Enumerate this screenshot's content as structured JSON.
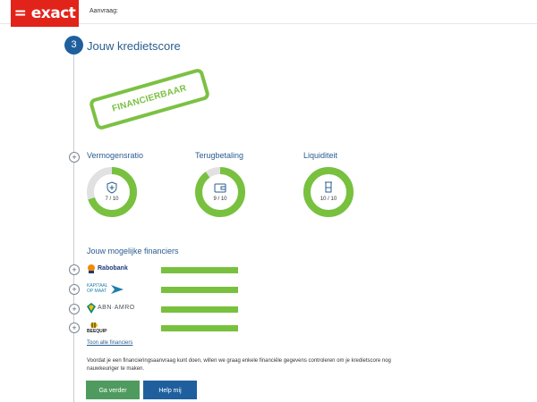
{
  "header": {
    "logo_text": "= exact",
    "aanvraag_label": "Aanvraag:"
  },
  "step": {
    "number": "3",
    "title": "Jouw kredietscore"
  },
  "stamp": {
    "text": "FINANCIERBAAR"
  },
  "metrics": [
    {
      "label": "Vermogensratio",
      "score": "7 / 10",
      "value": 7,
      "max": 10,
      "icon": "shield-plus-icon"
    },
    {
      "label": "Terugbetaling",
      "score": "9 / 10",
      "value": 9,
      "max": 10,
      "icon": "wallet-icon"
    },
    {
      "label": "Liquiditeit",
      "score": "10 / 10",
      "value": 10,
      "max": 10,
      "icon": "beaker-icon"
    }
  ],
  "financiers": {
    "title": "Jouw mogelijke financiers",
    "items": [
      {
        "name": "Rabobank"
      },
      {
        "name": "KAPITAAL OP MAAT"
      },
      {
        "name": "ABN·AMRO"
      },
      {
        "name": "BEEQUIP"
      }
    ],
    "show_all_link": "Toon alle financiers"
  },
  "info_text": "Voordat je een financieringsaanvraag kunt doen, willen we graag enkele financiële gegevens controleren om je kredietscore nog nauwkeuriger te maken.",
  "buttons": {
    "continue": "Ga verder",
    "help": "Help mij"
  },
  "colors": {
    "brand_red": "#e2231a",
    "score_green": "#78c13f",
    "track_gray": "#e1e1e1",
    "primary_blue": "#1f5f9e",
    "button_green": "#4f9b5f"
  }
}
